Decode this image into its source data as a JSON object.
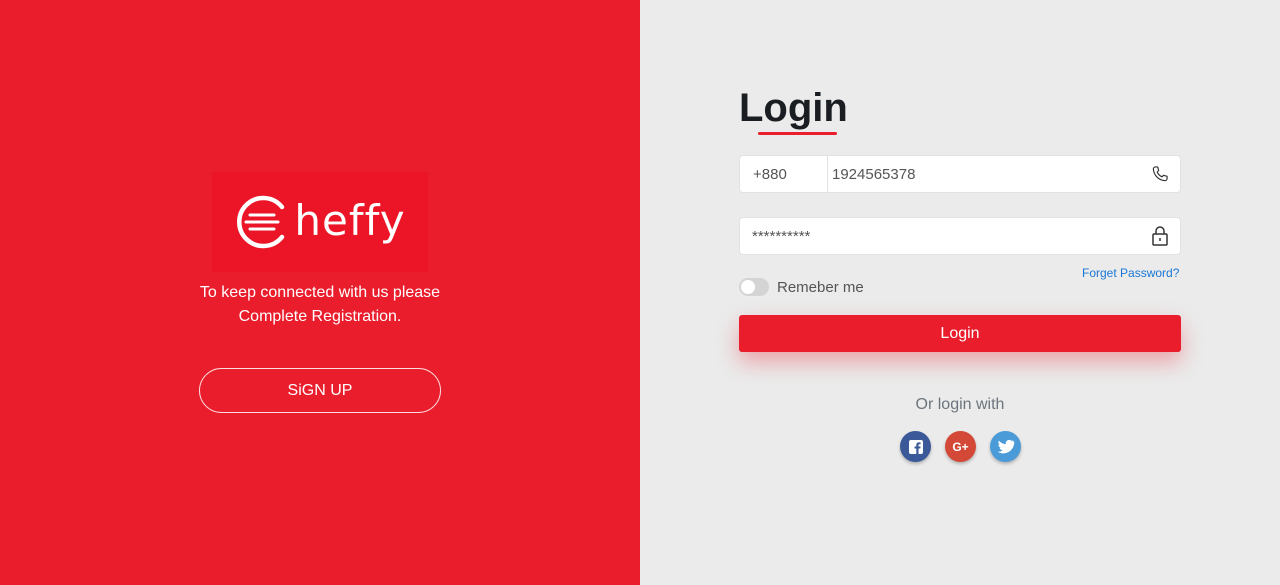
{
  "brand": {
    "logo_text": "heffy",
    "tagline_line1": "To keep connected with us please",
    "tagline_line2": "Complete Registration.",
    "signup_label": "SiGN UP",
    "color": "#ea1d2c"
  },
  "login": {
    "title": "Login",
    "phone_prefix": "+880",
    "phone_value": "1924565378",
    "password_value": "**********",
    "forget_label": "Forget Password?",
    "remember_label": "Remeber me",
    "remember_checked": false,
    "submit_label": "Login",
    "or_text": "Or login with"
  },
  "social": [
    {
      "name": "facebook",
      "icon": "facebook-icon",
      "color": "#3b5998"
    },
    {
      "name": "google-plus",
      "icon": "google-plus-icon",
      "color": "#d34836"
    },
    {
      "name": "twitter",
      "icon": "twitter-icon",
      "color": "#4a9bd8"
    }
  ]
}
